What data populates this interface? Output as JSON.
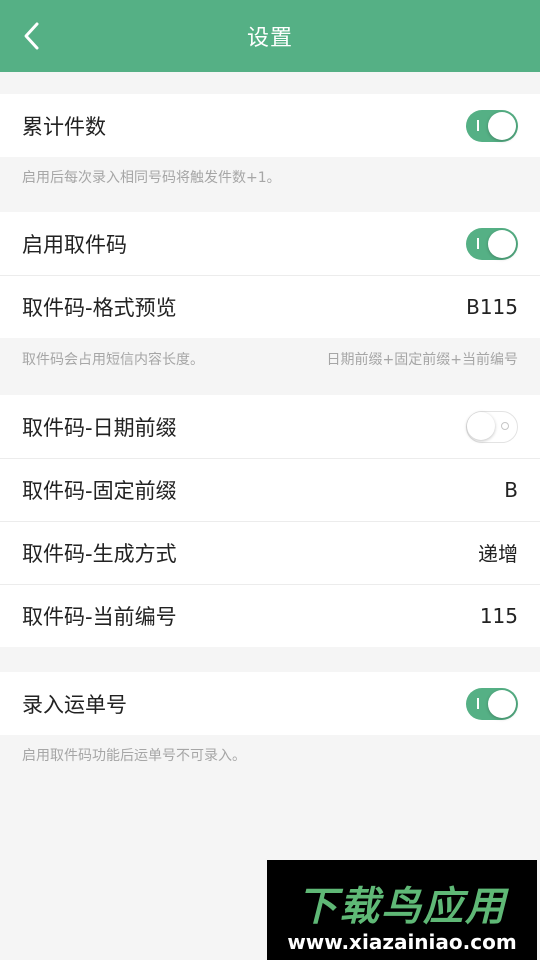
{
  "header": {
    "title": "设置",
    "back_icon": "chevron-left-icon"
  },
  "accent_color": "#55b085",
  "section1": {
    "rows": [
      {
        "label": "累计件数",
        "toggle_state": "on"
      }
    ],
    "note": "启用后每次录入相同号码将触发件数+1。"
  },
  "section2": {
    "rows": [
      {
        "label": "启用取件码",
        "toggle_state": "on"
      },
      {
        "label": "取件码-格式预览",
        "value": "B115"
      }
    ],
    "note_left": "取件码会占用短信内容长度。",
    "note_right": "日期前缀+固定前缀+当前编号"
  },
  "section3": {
    "rows": [
      {
        "label": "取件码-日期前缀",
        "toggle_state": "off"
      },
      {
        "label": "取件码-固定前缀",
        "value": "B"
      },
      {
        "label": "取件码-生成方式",
        "value": "递增"
      },
      {
        "label": "取件码-当前编号",
        "value": "115"
      }
    ]
  },
  "section4": {
    "rows": [
      {
        "label": "录入运单号",
        "toggle_state": "on"
      }
    ],
    "note": "启用取件码功能后运单号不可录入。"
  },
  "watermark": {
    "title": "下载鸟应用",
    "url": "www.xiazainiao.com"
  }
}
